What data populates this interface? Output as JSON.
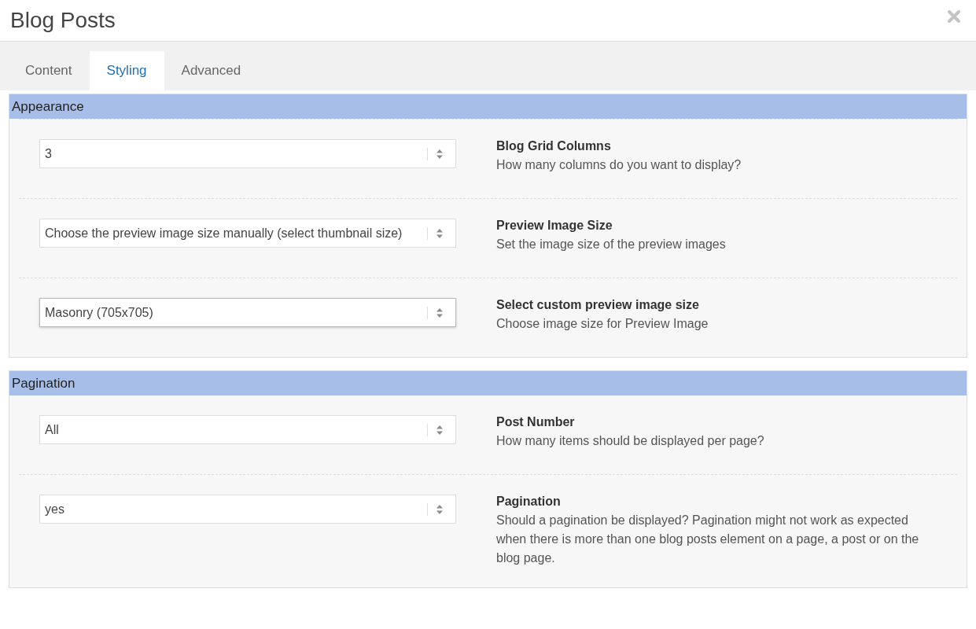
{
  "window": {
    "title": "Blog Posts"
  },
  "tabs": [
    {
      "label": "Content",
      "selected": false
    },
    {
      "label": "Styling",
      "selected": true
    },
    {
      "label": "Advanced",
      "selected": false
    }
  ],
  "sections": [
    {
      "title": "Appearance",
      "rows": [
        {
          "value": "3",
          "focused": false,
          "label": "Blog Grid Columns",
          "description": "How many columns do you want to display?"
        },
        {
          "value": "Choose the preview image size manually (select thumbnail size)",
          "focused": false,
          "label": "Preview Image Size",
          "description": "Set the image size of the preview images"
        },
        {
          "value": "Masonry (705x705)",
          "focused": true,
          "label": "Select custom preview image size",
          "description": "Choose image size for Preview Image"
        }
      ]
    },
    {
      "title": "Pagination",
      "rows": [
        {
          "value": "All",
          "focused": false,
          "label": "Post Number",
          "description": "How many items should be displayed per page?"
        },
        {
          "value": "yes",
          "focused": false,
          "label": "Pagination",
          "description": "Should a pagination be displayed? Pagination might not work as expected when there is more than one blog posts element on a page, a post or on the blog page."
        }
      ]
    }
  ]
}
